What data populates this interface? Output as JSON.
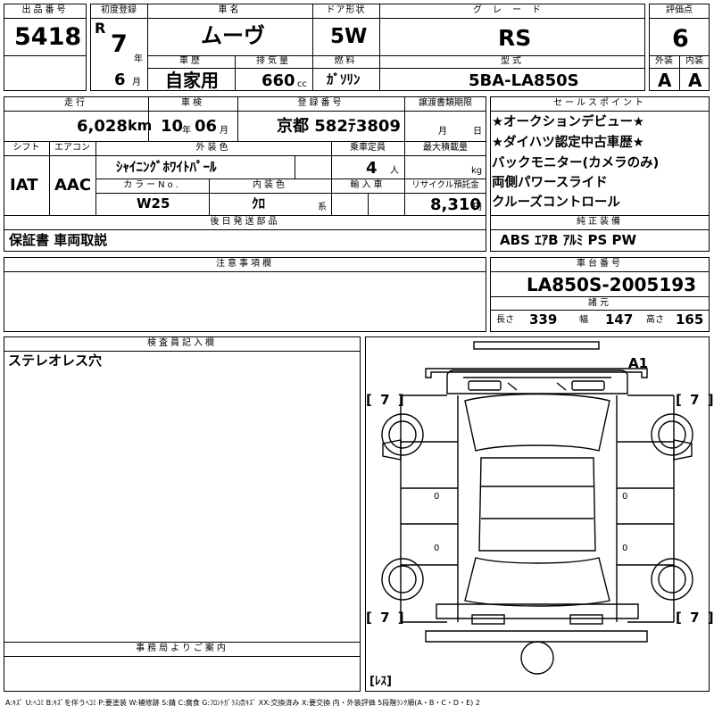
{
  "header": {
    "lot_no_label": "出品番号",
    "lot_no": "5418",
    "first_reg_label": "初度登録",
    "era": "R",
    "reg_year": "7",
    "year_unit": "年",
    "reg_month": "6",
    "month_unit": "月",
    "car_name_label": "車名",
    "car_name": "ムーヴ",
    "door_label": "ドア形状",
    "door": "5W",
    "grade_label": "グレード",
    "grade": "RS",
    "score_label": "評価点",
    "score": "6",
    "history_label": "車歴",
    "history": "自家用",
    "displacement_label": "排気量",
    "displacement": "660",
    "cc_unit": "cc",
    "fuel_label": "燃料",
    "fuel": "ｶﾞｿﾘﾝ",
    "model_label": "型式",
    "model": "5BA-LA850S",
    "exterior_label": "外装",
    "exterior": "A",
    "interior_label": "内装",
    "interior": "A"
  },
  "row2": {
    "mileage_label": "走行",
    "mileage": "6,028",
    "km_unit": "km",
    "inspection_label": "車検",
    "insp_year": "10",
    "insp_year_unit": "年",
    "insp_month": "06",
    "insp_month_unit": "月",
    "plate_label": "登録番号",
    "plate": "京都 582ﾃ3809",
    "transfer_label": "譲渡書類期限",
    "transfer_month_unit": "月",
    "transfer_day_unit": "日",
    "shift_label": "シフト",
    "shift": "IAT",
    "ac_label": "エアコン",
    "ac": "AAC",
    "ext_color_label": "外装色",
    "ext_color": "ｼｬｲﾆﾝｸﾞﾎﾜｲﾄﾊﾟｰﾙ",
    "capacity_label": "乗車定員",
    "capacity": "4",
    "capacity_unit": "人",
    "max_load_label": "最大積載量",
    "max_load_unit": "kg",
    "color_no_label": "カラーNo.",
    "color_no": "W25",
    "int_color_label": "内装色",
    "int_color": "ｸﾛ",
    "int_color_unit": "系",
    "import_label": "輸入車",
    "recycle_label": "リサイクル預託金",
    "recycle": "8,310",
    "recycle_unit": "円",
    "later_parts_label": "後日発送部品",
    "later_parts": "保証書 車両取説"
  },
  "selling_points": {
    "label": "セールスポイント",
    "items": [
      "★オークションデビュー★",
      "★ダイハツ認定中古車歴★",
      "バックモニター(カメラのみ)",
      "両側パワースライド",
      "クルーズコントロール"
    ]
  },
  "equipment": {
    "label": "純正装備",
    "value": "ABS ｴｱB ｱﾙﾐ PS PW"
  },
  "notes": {
    "label": "注意事項欄"
  },
  "chassis": {
    "label": "車台番号",
    "value": "LA850S-2005193"
  },
  "dims": {
    "label": "諸元",
    "length_label": "長さ",
    "length": "339",
    "width_label": "幅",
    "width": "147",
    "height_label": "高さ",
    "height": "165"
  },
  "inspector": {
    "label": "検査員記入欄",
    "text": "ステレオレス穴"
  },
  "office": {
    "label": "事務局よりご案内"
  },
  "diagram": {
    "a1": "A1",
    "tire_fl": "7",
    "tire_fr": "7",
    "tire_rl": "7",
    "tire_rr": "7",
    "spare": "ﾚｽ",
    "bracket_l": "[",
    "bracket_r": "]",
    "zero": "0"
  },
  "legend": "A:ｷｽﾞ U:ﾍｺﾐ B:ｷｽﾞを伴うﾍｺﾐ P:要塗装 W:補修跡 S:錆 C:腐食 G:ﾌﾛﾝﾄｶﾞﾗｽ点ｷｽﾞ XX:交換済み X:要交換 内・外装評価 5段階ﾗﾝｸ順(A・B・C・D・E) 2"
}
